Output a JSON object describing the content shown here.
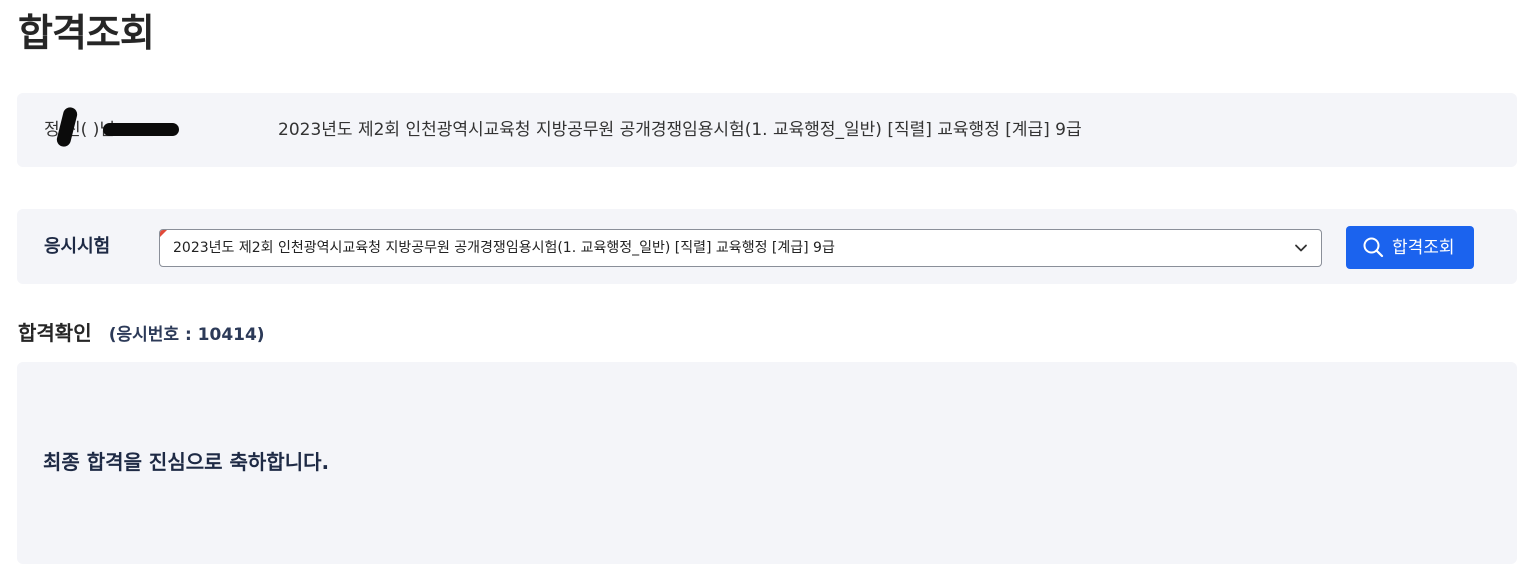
{
  "page": {
    "title": "합격조회"
  },
  "applicant": {
    "name_text": "정 진( )님.",
    "exam_name": "2023년도 제2회 인천광역시교육청 지방공무원 공개경쟁임용시험(1. 교육행정_일반) [직렬] 교육행정 [계급] 9급"
  },
  "exam_select": {
    "label": "응시시험",
    "selected_value": "2023년도 제2회 인천광역시교육청 지방공무원 공개경쟁임용시험(1. 교육행정_일반) [직렬] 교육행정 [계급] 9급",
    "chevron_icon": "chevron-down-icon"
  },
  "search_button": {
    "label": "합격조회",
    "icon": "search-icon",
    "color": "#1b63ee"
  },
  "result": {
    "section_title": "합격확인",
    "exam_number_text": "(응시번호 : 10414)",
    "message": "최종 합격을 진심으로 축하합니다."
  },
  "colors": {
    "panel_background": "#f4f5f9",
    "primary": "#1b63ee",
    "heading_text": "#1e2a45"
  }
}
